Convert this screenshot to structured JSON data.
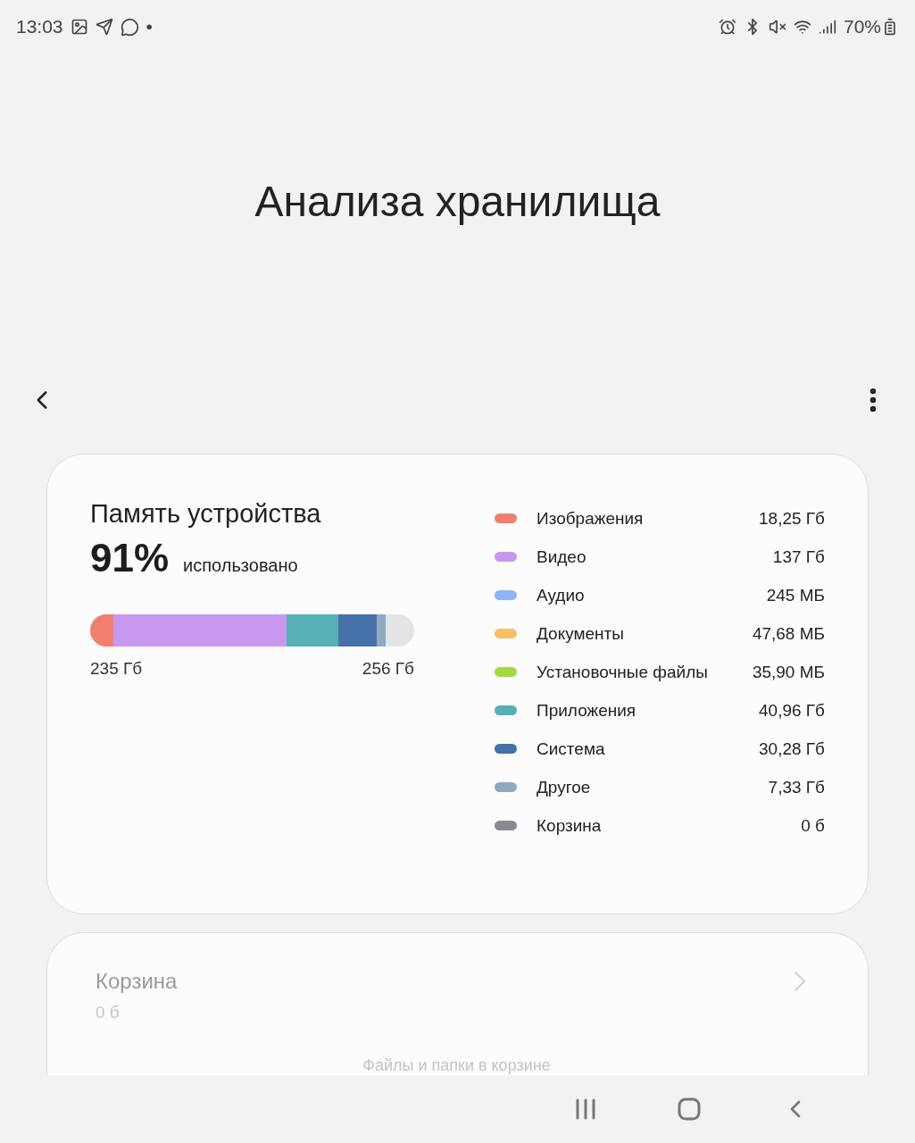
{
  "status_bar": {
    "time": "13:03",
    "dot": "•",
    "battery": "70%"
  },
  "header": {
    "title": "Анализа хранилища"
  },
  "storage_card": {
    "title": "Память устройства",
    "percent": "91%",
    "used_label": "использовано",
    "usage_bar": [
      {
        "color": "#f07f6e"
      },
      {
        "color": "#c897f0"
      },
      {
        "color": "#56b0b6"
      },
      {
        "color": "#4472a8"
      },
      {
        "color": "#8ea9c0"
      }
    ],
    "used": "235 Гб",
    "total": "256 Гб",
    "legend": [
      {
        "label": "Изображения",
        "value": "18,25 Гб",
        "color": "#f07f6e"
      },
      {
        "label": "Видео",
        "value": "137 Гб",
        "color": "#c897f0"
      },
      {
        "label": "Аудио",
        "value": "245 МБ",
        "color": "#8fb4f5"
      },
      {
        "label": "Документы",
        "value": "47,68 МБ",
        "color": "#f5c064"
      },
      {
        "label": "Установочные файлы",
        "value": "35,90 МБ",
        "color": "#a5d93c"
      },
      {
        "label": "Приложения",
        "value": "40,96 Гб",
        "color": "#56b0b6"
      },
      {
        "label": "Система",
        "value": "30,28 Гб",
        "color": "#4472a8"
      },
      {
        "label": "Другое",
        "value": "7,33 Гб",
        "color": "#8ea9c0"
      },
      {
        "label": "Корзина",
        "value": "0 б",
        "color": "#8a8a94"
      }
    ]
  },
  "trash_card": {
    "title": "Корзина",
    "size": "0 б",
    "description": "Файлы и папки в корзине",
    "disabled": true
  }
}
